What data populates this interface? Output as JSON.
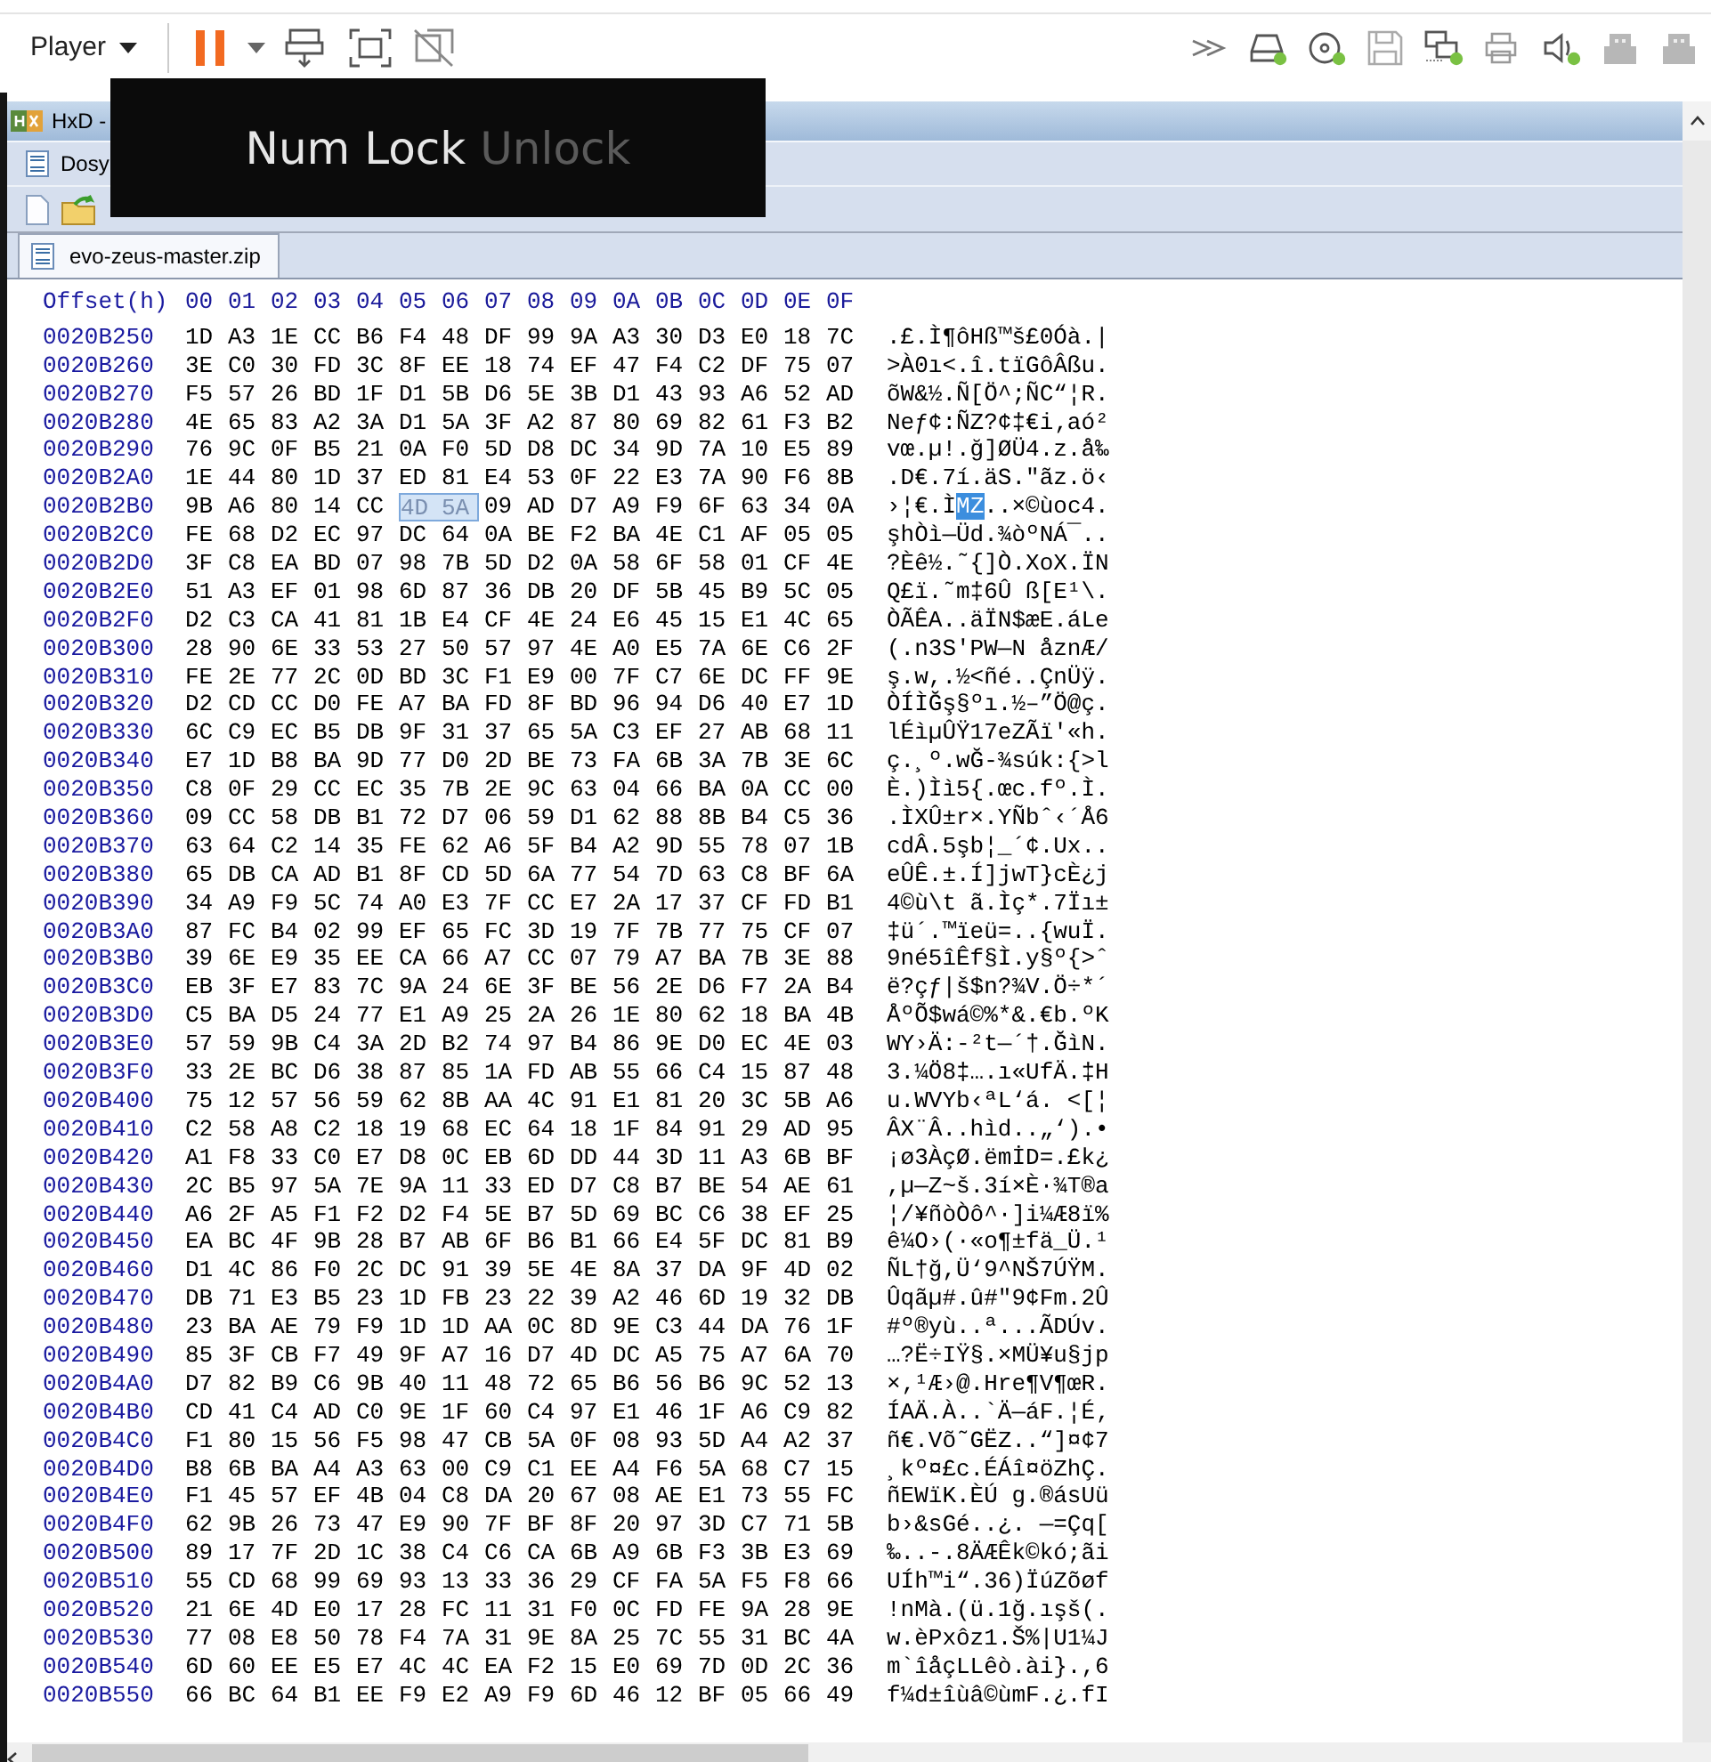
{
  "vm_toolbar": {
    "menu": "Player",
    "devices": [
      {
        "kind": "disk",
        "connected": true
      },
      {
        "kind": "optical",
        "connected": true
      },
      {
        "kind": "floppy",
        "connected": false
      },
      {
        "kind": "network",
        "connected": true
      },
      {
        "kind": "printer",
        "connected": false
      },
      {
        "kind": "sound",
        "connected": true
      },
      {
        "kind": "usb",
        "connected": false
      },
      {
        "kind": "usb",
        "connected": false
      }
    ]
  },
  "window": {
    "title": "HxD -",
    "menu": [
      "Dosy"
    ],
    "tabs": [
      {
        "label": "evo-zeus-master.zip",
        "selected": true
      }
    ]
  },
  "hex": {
    "header": {
      "offset": "Offset(h)",
      "columns": [
        "00",
        "01",
        "02",
        "03",
        "04",
        "05",
        "06",
        "07",
        "08",
        "09",
        "0A",
        "0B",
        "0C",
        "0D",
        "0E",
        "0F"
      ]
    },
    "rows": [
      {
        "offset": "0020B250",
        "bytes": "1D A3 1E CC B6 F4 48 DF 99 9A A3 30 D3 E0 18 7C",
        "text": ".£.Ì¶ôHß™š£0Óà.|"
      },
      {
        "offset": "0020B260",
        "bytes": "3E C0 30 FD 3C 8F EE 18 74 EF 47 F4 C2 DF 75 07",
        "text": ">À0ı<.î.tïGôÂßu."
      },
      {
        "offset": "0020B270",
        "bytes": "F5 57 26 BD 1F D1 5B D6 5E 3B D1 43 93 A6 52 AD",
        "text": "õW&½.Ñ[Ö^;ÑC“¦R."
      },
      {
        "offset": "0020B280",
        "bytes": "4E 65 83 A2 3A D1 5A 3F A2 87 80 69 82 61 F3 B2",
        "text": "Neƒ¢:ÑZ?¢‡€i‚aó²"
      },
      {
        "offset": "0020B290",
        "bytes": "76 9C 0F B5 21 0A F0 5D D8 DC 34 9D 7A 10 E5 89",
        "text": "vœ.µ!.ğ]ØÜ4.z.å‰"
      },
      {
        "offset": "0020B2A0",
        "bytes": "1E 44 80 1D 37 ED 81 E4 53 0F 22 E3 7A 90 F6 8B",
        "text": ".D€.7í.äS.\"ãz.ö‹"
      },
      {
        "offset": "0020B2B0",
        "bytes": "9B A6 80 14 CC 4D 5A 09 AD D7 A9 F9 6F 63 34 0A",
        "text": "›¦€.ÌMZ..×©ùoc4.",
        "selected_bytes": [
          false,
          false,
          false,
          false,
          false,
          true,
          true,
          false,
          false,
          false,
          false,
          false,
          false,
          false,
          false,
          false
        ]
      },
      {
        "offset": "0020B2C0",
        "bytes": "FE 68 D2 EC 97 DC 64 0A BE F2 BA 4E C1 AF 05 05",
        "text": "şhÒì—Üd.¾òºNÁ¯.."
      },
      {
        "offset": "0020B2D0",
        "bytes": "3F C8 EA BD 07 98 7B 5D D2 0A 58 6F 58 01 CF 4E",
        "text": "?Èê½.˜{]Ò.XoX.ÏN"
      },
      {
        "offset": "0020B2E0",
        "bytes": "51 A3 EF 01 98 6D 87 36 DB 20 DF 5B 45 B9 5C 05",
        "text": "Q£ï.˜m‡6Û ß[E¹\\."
      },
      {
        "offset": "0020B2F0",
        "bytes": "D2 C3 CA 41 81 1B E4 CF 4E 24 E6 45 15 E1 4C 65",
        "text": "ÒÃÊA..äÏN$æE.áLe"
      },
      {
        "offset": "0020B300",
        "bytes": "28 90 6E 33 53 27 50 57 97 4E A0 E5 7A 6E C6 2F",
        "text": "(.n3S'PW—N åznÆ/"
      },
      {
        "offset": "0020B310",
        "bytes": "FE 2E 77 2C 0D BD 3C F1 E9 00 7F C7 6E DC FF 9E",
        "text": "ş.w,.½<ñé..ÇnÜÿ."
      },
      {
        "offset": "0020B320",
        "bytes": "D2 CD CC D0 FE A7 BA FD 8F BD 96 94 D6 40 E7 1D",
        "text": "ÒÍÌĞş§ºı.½–”Ö@ç."
      },
      {
        "offset": "0020B330",
        "bytes": "6C C9 EC B5 DB 9F 31 37 65 5A C3 EF 27 AB 68 11",
        "text": "lÉìµÛŸ17eZÃï'«h."
      },
      {
        "offset": "0020B340",
        "bytes": "E7 1D B8 BA 9D 77 D0 2D BE 73 FA 6B 3A 7B 3E 6C",
        "text": "ç.¸º.wĞ-¾súk:{>l"
      },
      {
        "offset": "0020B350",
        "bytes": "C8 0F 29 CC EC 35 7B 2E 9C 63 04 66 BA 0A CC 00",
        "text": "È.)Ìì5{.œc.fº.Ì."
      },
      {
        "offset": "0020B360",
        "bytes": "09 CC 58 DB B1 72 D7 06 59 D1 62 88 8B B4 C5 36",
        "text": ".ÌXÛ±r×.YÑbˆ‹´Å6"
      },
      {
        "offset": "0020B370",
        "bytes": "63 64 C2 14 35 FE 62 A6 5F B4 A2 9D 55 78 07 1B",
        "text": "cdÂ.5şb¦_´¢.Ux.."
      },
      {
        "offset": "0020B380",
        "bytes": "65 DB CA AD B1 8F CD 5D 6A 77 54 7D 63 C8 BF 6A",
        "text": "eÛÊ.±.Í]jwT}cÈ¿j"
      },
      {
        "offset": "0020B390",
        "bytes": "34 A9 F9 5C 74 A0 E3 7F CC E7 2A 17 37 CF FD B1",
        "text": "4©ù\\t ã.Ìç*.7Ïı±"
      },
      {
        "offset": "0020B3A0",
        "bytes": "87 FC B4 02 99 EF 65 FC 3D 19 7F 7B 77 75 CF 07",
        "text": "‡ü´.™ïeü=..{wuÏ."
      },
      {
        "offset": "0020B3B0",
        "bytes": "39 6E E9 35 EE CA 66 A7 CC 07 79 A7 BA 7B 3E 88",
        "text": "9né5îÊf§Ì.y§º{>ˆ"
      },
      {
        "offset": "0020B3C0",
        "bytes": "EB 3F E7 83 7C 9A 24 6E 3F BE 56 2E D6 F7 2A B4",
        "text": "ë?çƒ|š$n?¾V.Ö÷*´"
      },
      {
        "offset": "0020B3D0",
        "bytes": "C5 BA D5 24 77 E1 A9 25 2A 26 1E 80 62 18 BA 4B",
        "text": "ÅºÕ$wá©%*&.€b.ºK"
      },
      {
        "offset": "0020B3E0",
        "bytes": "57 59 9B C4 3A 2D B2 74 97 B4 86 9E D0 EC 4E 03",
        "text": "WY›Ä:-²t—´†.ĞìN."
      },
      {
        "offset": "0020B3F0",
        "bytes": "33 2E BC D6 38 87 85 1A FD AB 55 66 C4 15 87 48",
        "text": "3.¼Ö8‡….ı«UfÄ.‡H"
      },
      {
        "offset": "0020B400",
        "bytes": "75 12 57 56 59 62 8B AA 4C 91 E1 81 20 3C 5B A6",
        "text": "u.WVYb‹ªL‘á. <[¦"
      },
      {
        "offset": "0020B410",
        "bytes": "C2 58 A8 C2 18 19 68 EC 64 18 1F 84 91 29 AD 95",
        "text": "ÂX¨Â..hìd..„‘).•"
      },
      {
        "offset": "0020B420",
        "bytes": "A1 F8 33 C0 E7 D8 0C EB 6D DD 44 3D 11 A3 6B BF",
        "text": "¡ø3ÀçØ.ëmİD=.£k¿"
      },
      {
        "offset": "0020B430",
        "bytes": "2C B5 97 5A 7E 9A 11 33 ED D7 C8 B7 BE 54 AE 61",
        "text": ",µ—Z~š.3í×È·¾T®a"
      },
      {
        "offset": "0020B440",
        "bytes": "A6 2F A5 F1 F2 D2 F4 5E B7 5D 69 BC C6 38 EF 25",
        "text": "¦/¥ñòÒô^·]i¼Æ8ï%"
      },
      {
        "offset": "0020B450",
        "bytes": "EA BC 4F 9B 28 B7 AB 6F B6 B1 66 E4 5F DC 81 B9",
        "text": "ê¼O›(·«o¶±fä_Ü.¹"
      },
      {
        "offset": "0020B460",
        "bytes": "D1 4C 86 F0 2C DC 91 39 5E 4E 8A 37 DA 9F 4D 02",
        "text": "ÑL†ğ,Ü‘9^NŠ7ÚŸM."
      },
      {
        "offset": "0020B470",
        "bytes": "DB 71 E3 B5 23 1D FB 23 22 39 A2 46 6D 19 32 DB",
        "text": "Ûqãµ#.û#\"9¢Fm.2Û"
      },
      {
        "offset": "0020B480",
        "bytes": "23 BA AE 79 F9 1D 1D AA 0C 8D 9E C3 44 DA 76 1F",
        "text": "#º®yù..ª...ÃDÚv."
      },
      {
        "offset": "0020B490",
        "bytes": "85 3F CB F7 49 9F A7 16 D7 4D DC A5 75 A7 6A 70",
        "text": "…?Ë÷IŸ§.×MÜ¥u§jp"
      },
      {
        "offset": "0020B4A0",
        "bytes": "D7 82 B9 C6 9B 40 11 48 72 65 B6 56 B6 9C 52 13",
        "text": "×‚¹Æ›@.Hre¶V¶œR."
      },
      {
        "offset": "0020B4B0",
        "bytes": "CD 41 C4 AD C0 9E 1F 60 C4 97 E1 46 1F A6 C9 82",
        "text": "ÍAÄ.À..`Ä—áF.¦É‚"
      },
      {
        "offset": "0020B4C0",
        "bytes": "F1 80 15 56 F5 98 47 CB 5A 0F 08 93 5D A4 A2 37",
        "text": "ñ€.Võ˜GËZ..“]¤¢7"
      },
      {
        "offset": "0020B4D0",
        "bytes": "B8 6B BA A4 A3 63 00 C9 C1 EE A4 F6 5A 68 C7 15",
        "text": "¸kº¤£c.ÉÁî¤öZhÇ."
      },
      {
        "offset": "0020B4E0",
        "bytes": "F1 45 57 EF 4B 04 C8 DA 20 67 08 AE E1 73 55 FC",
        "text": "ñEWïK.ÈÚ g.®ásUü"
      },
      {
        "offset": "0020B4F0",
        "bytes": "62 9B 26 73 47 E9 90 7F BF 8F 20 97 3D C7 71 5B",
        "text": "b›&sGé..¿. —=Çq["
      },
      {
        "offset": "0020B500",
        "bytes": "89 17 7F 2D 1C 38 C4 C6 CA 6B A9 6B F3 3B E3 69",
        "text": "‰..-.8ÄÆÊk©kó;ãi"
      },
      {
        "offset": "0020B510",
        "bytes": "55 CD 68 99 69 93 13 33 36 29 CF FA 5A F5 F8 66",
        "text": "UÍh™i“.36)ÏúZõøf"
      },
      {
        "offset": "0020B520",
        "bytes": "21 6E 4D E0 17 28 FC 11 31 F0 0C FD FE 9A 28 9E",
        "text": "!nMà.(ü.1ğ.ışš(."
      },
      {
        "offset": "0020B530",
        "bytes": "77 08 E8 50 78 F4 7A 31 9E 8A 25 7C 55 31 BC 4A",
        "text": "w.èPxôz1.Š%|U1¼J"
      },
      {
        "offset": "0020B540",
        "bytes": "6D 60 EE E5 E7 4C 4C EA F2 15 E0 69 7D 0D 2C 36",
        "text": "m`îåçLLêò.ài}.,6"
      },
      {
        "offset": "0020B550",
        "bytes": "66 BC 64 B1 EE F9 E2 A9 F9 6D 46 12 BF 05 66 49",
        "text": "f¼d±îùâ©ùmF.¿.fI"
      }
    ]
  },
  "osd": {
    "key": "Num Lock",
    "state": "Unlock"
  }
}
